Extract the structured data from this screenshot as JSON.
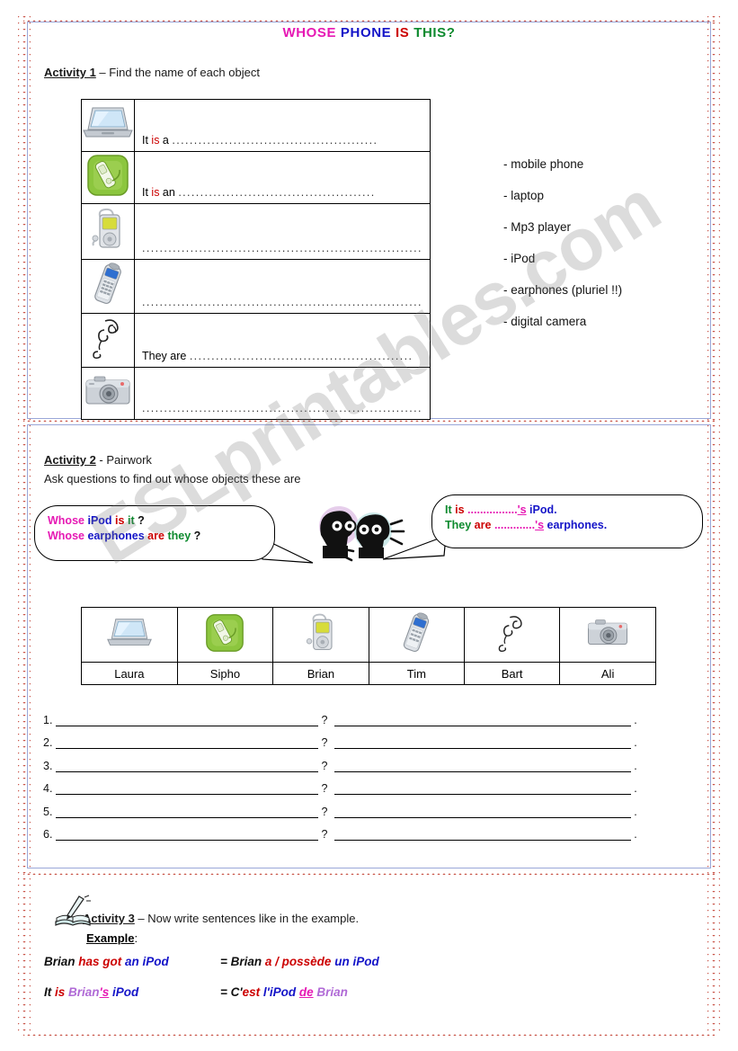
{
  "title": {
    "word1": "WHOSE",
    "word2": "PHONE",
    "word3": "IS",
    "word4": "THIS?",
    "colors": {
      "word1": "#e619b4",
      "word2": "#1414c8",
      "word3": "#cc0000",
      "word4": "#0d8a2e"
    }
  },
  "watermark": "ESLprintables.com",
  "activity1": {
    "heading_bold": "Activity 1",
    "heading_rest": " – Find the name of each object",
    "rows": [
      {
        "icon": "laptop-icon",
        "prefix_it": "It ",
        "prefix_is": "is",
        "prefix_art": " a ",
        "dots": "..............................................."
      },
      {
        "icon": "green-phone-icon",
        "prefix_it": "It ",
        "prefix_is": "is",
        "prefix_art": " an ",
        "dots": "............................................."
      },
      {
        "icon": "ipod-icon",
        "prefix_it": "",
        "prefix_is": "",
        "prefix_art": "",
        "dots": "................................................................"
      },
      {
        "icon": "mobile-phone-icon",
        "prefix_it": "",
        "prefix_is": "",
        "prefix_art": "",
        "dots": "................................................................"
      },
      {
        "icon": "earphones-icon",
        "prefix_it": "They are ",
        "prefix_is": "",
        "prefix_art": "",
        "dots": "..................................................."
      },
      {
        "icon": "camera-icon",
        "prefix_it": "",
        "prefix_is": "",
        "prefix_art": "",
        "dots": "................................................................"
      }
    ],
    "wordlist": [
      "- mobile phone",
      "- laptop",
      "- Mp3 player",
      "- iPod",
      "- earphones (pluriel !!)",
      "- digital camera"
    ]
  },
  "activity2": {
    "heading_bold": "Activity 2",
    "heading_rest": " - Pairwork",
    "subheading": "Ask questions to find out whose objects these are",
    "bubble_left": {
      "line1": {
        "whose": "Whose",
        "noun": "iPod",
        "verb": "is",
        "pronoun": "it",
        "mark": "?"
      },
      "line2": {
        "whose": "Whose",
        "noun": "earphones",
        "verb": "are",
        "pronoun": "they",
        "mark": "?"
      }
    },
    "bubble_right": {
      "line1": {
        "subject": "It",
        "verb": "is",
        "dots": "................",
        "apos": "'s",
        "noun": "iPod."
      },
      "line2": {
        "subject": "They",
        "verb": "are",
        "dots": ".............",
        "apos": "'s",
        "noun": "earphones."
      }
    },
    "names_table": {
      "cells": [
        {
          "icon": "laptop-icon",
          "name": "Laura"
        },
        {
          "icon": "green-phone-icon",
          "name": "Sipho"
        },
        {
          "icon": "ipod-icon",
          "name": "Brian"
        },
        {
          "icon": "mobile-phone-icon",
          "name": "Tim"
        },
        {
          "icon": "earphones-icon",
          "name": "Bart"
        },
        {
          "icon": "camera-icon",
          "name": "Ali"
        }
      ]
    },
    "lines": [
      {
        "num": "1.",
        "qmark": "?",
        "period": "."
      },
      {
        "num": "2.",
        "qmark": "?",
        "period": "."
      },
      {
        "num": "3.",
        "qmark": "?",
        "period": "."
      },
      {
        "num": "4.",
        "qmark": "?",
        "period": "."
      },
      {
        "num": "5.",
        "qmark": "?",
        "period": "."
      },
      {
        "num": "6.",
        "qmark": "?",
        "period": "."
      }
    ]
  },
  "activity3": {
    "heading_bold": "Activity 3",
    "heading_rest": " – Now write sentences like in the example.",
    "example_label": "Example",
    "example_colon": ":",
    "row1_left": {
      "p1": "Brian ",
      "p2": "has got",
      "p3": " an iPod"
    },
    "row1_right": {
      "p1": "= Brian ",
      "p2": "a / possède",
      "p3": " un iPod"
    },
    "row2_left": {
      "p1": "It ",
      "p2": "is ",
      "p3": "Brian",
      "p4": "'s",
      "p5": " iPod"
    },
    "row2_right": {
      "p1": "= C'",
      "p2": "est",
      "p3": " l'iPod ",
      "p4": "de",
      "p5": " Brian"
    }
  }
}
